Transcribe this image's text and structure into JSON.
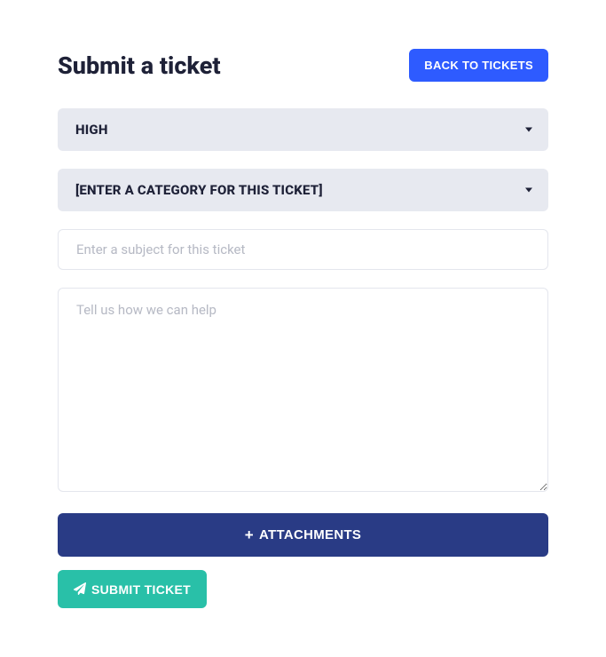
{
  "header": {
    "title": "Submit a ticket",
    "back_label": "BACK TO TICKETS"
  },
  "form": {
    "priority": {
      "selected": "HIGH"
    },
    "category": {
      "selected": "[ENTER A CATEGORY FOR THIS TICKET]"
    },
    "subject": {
      "value": "",
      "placeholder": "Enter a subject for this ticket"
    },
    "description": {
      "value": "",
      "placeholder": "Tell us how we can help"
    },
    "attachments_label": "ATTACHMENTS",
    "submit_label": "SUBMIT TICKET"
  }
}
